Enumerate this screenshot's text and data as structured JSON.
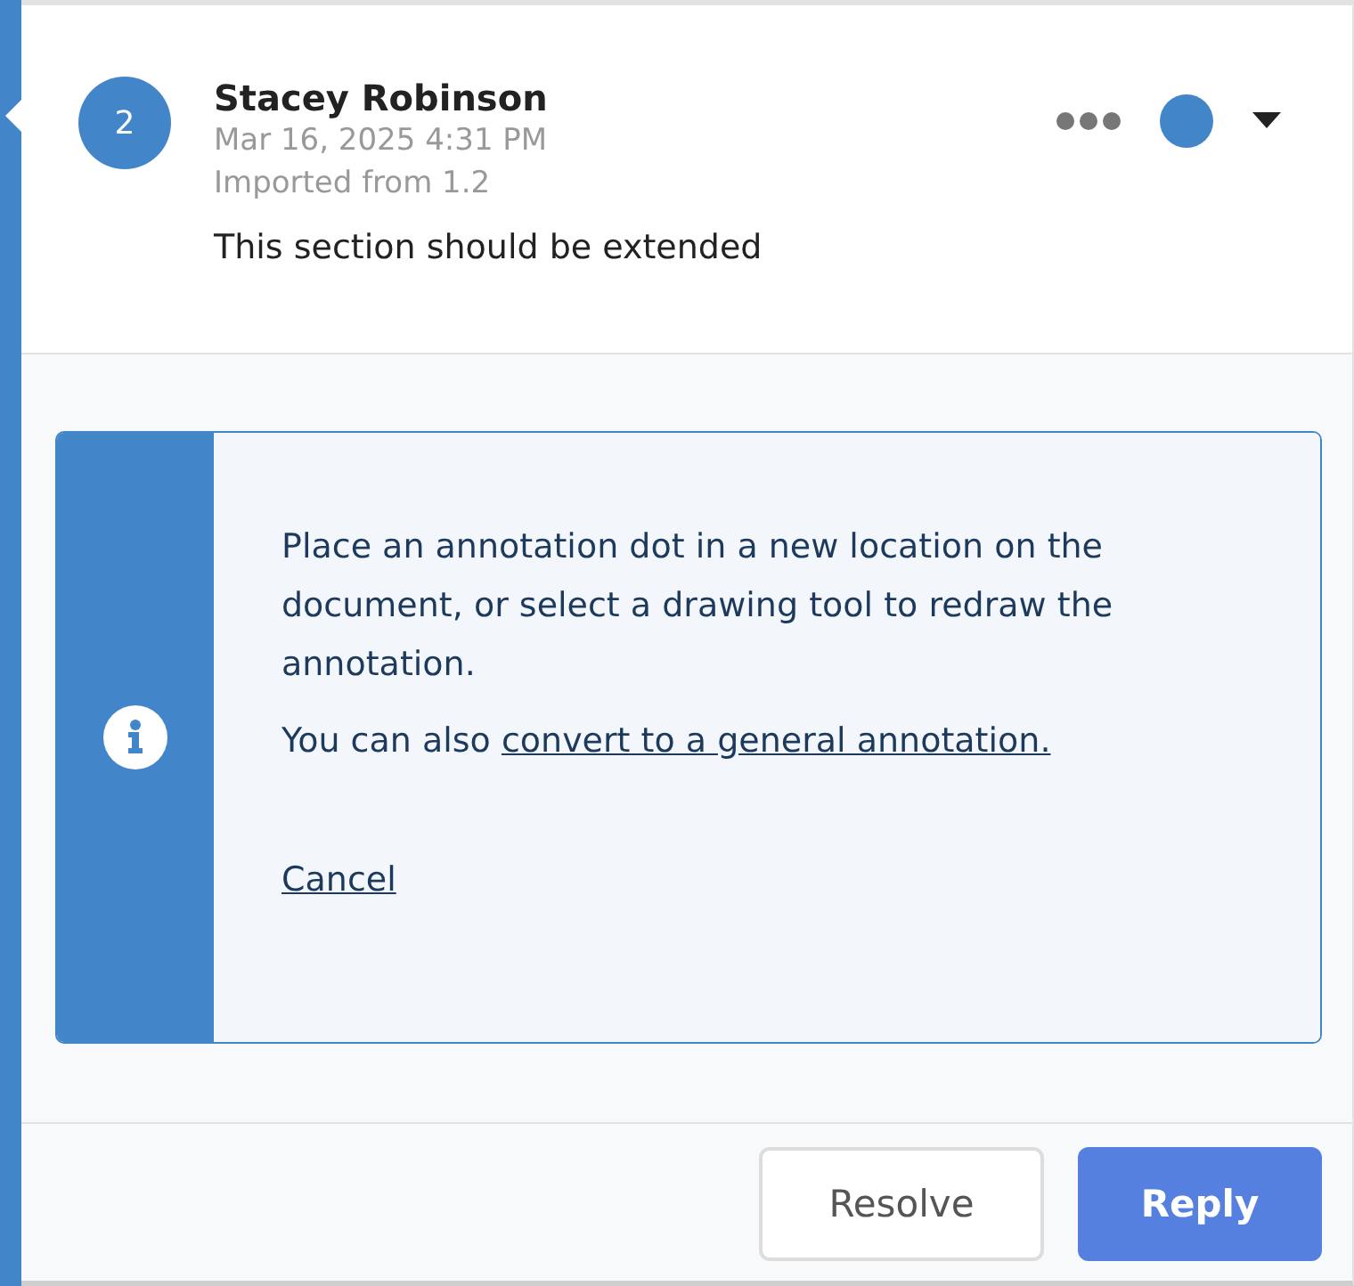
{
  "comment": {
    "number": "2",
    "author": "Stacey Robinson",
    "timestamp": "Mar 16, 2025 4:31 PM",
    "source": "Imported from 1.2",
    "text": "This section should be extended",
    "status": {
      "color": "#4285c9"
    }
  },
  "notice": {
    "message": "Place an annotation dot in a new location on the document, or select a drawing tool to redraw the annotation.",
    "convert_prefix": "You can also ",
    "convert_link": "convert to a general annotation.",
    "cancel": "Cancel"
  },
  "buttons": [
    {
      "label": "Resolve",
      "kind": "secondary"
    },
    {
      "label": "Reply",
      "kind": "primary"
    }
  ]
}
